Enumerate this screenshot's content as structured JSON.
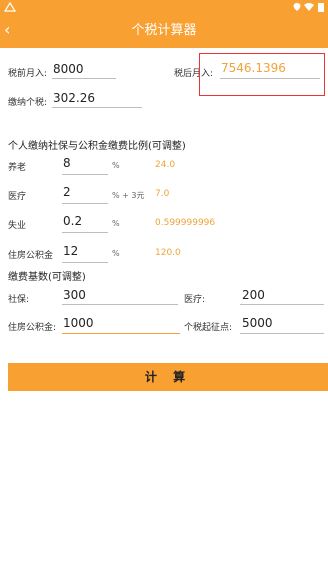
{
  "app": {
    "title": "个税计算器"
  },
  "statusbar": {
    "icons": [
      "alert-icon",
      "location-icon",
      "wifi-icon",
      "battery-icon"
    ]
  },
  "income": {
    "pre_tax_label": "税前月入:",
    "pre_tax_value": "8000",
    "after_tax_label": "税后月入:",
    "after_tax_value": "7546.1396",
    "tax_label": "缴纳个税:",
    "tax_value": "302.26"
  },
  "rates": {
    "heading": "个人缴纳社保与公积金缴费比例(可调整)",
    "items": [
      {
        "label": "养老",
        "value": "8",
        "unit": "%",
        "result": "24.0"
      },
      {
        "label": "医疗",
        "value": "2",
        "unit": "% + 3元",
        "result": "7.0"
      },
      {
        "label": "失业",
        "value": "0.2",
        "unit": "%",
        "result": "0.599999996"
      },
      {
        "label": "住房公积金",
        "value": "12",
        "unit": "%",
        "result": "120.0"
      }
    ]
  },
  "base": {
    "heading": "缴费基数(可调整)",
    "social_label": "社保:",
    "social_value": "300",
    "medical_label": "医疗:",
    "medical_value": "200",
    "fund_label": "住房公积金:",
    "fund_value": "1000",
    "threshold_label": "个税起征点:",
    "threshold_value": "5000"
  },
  "actions": {
    "calculate_label": "计 算"
  },
  "colors": {
    "accent": "#f9a032",
    "result": "#f0a33a",
    "highlight": "#e33333"
  }
}
